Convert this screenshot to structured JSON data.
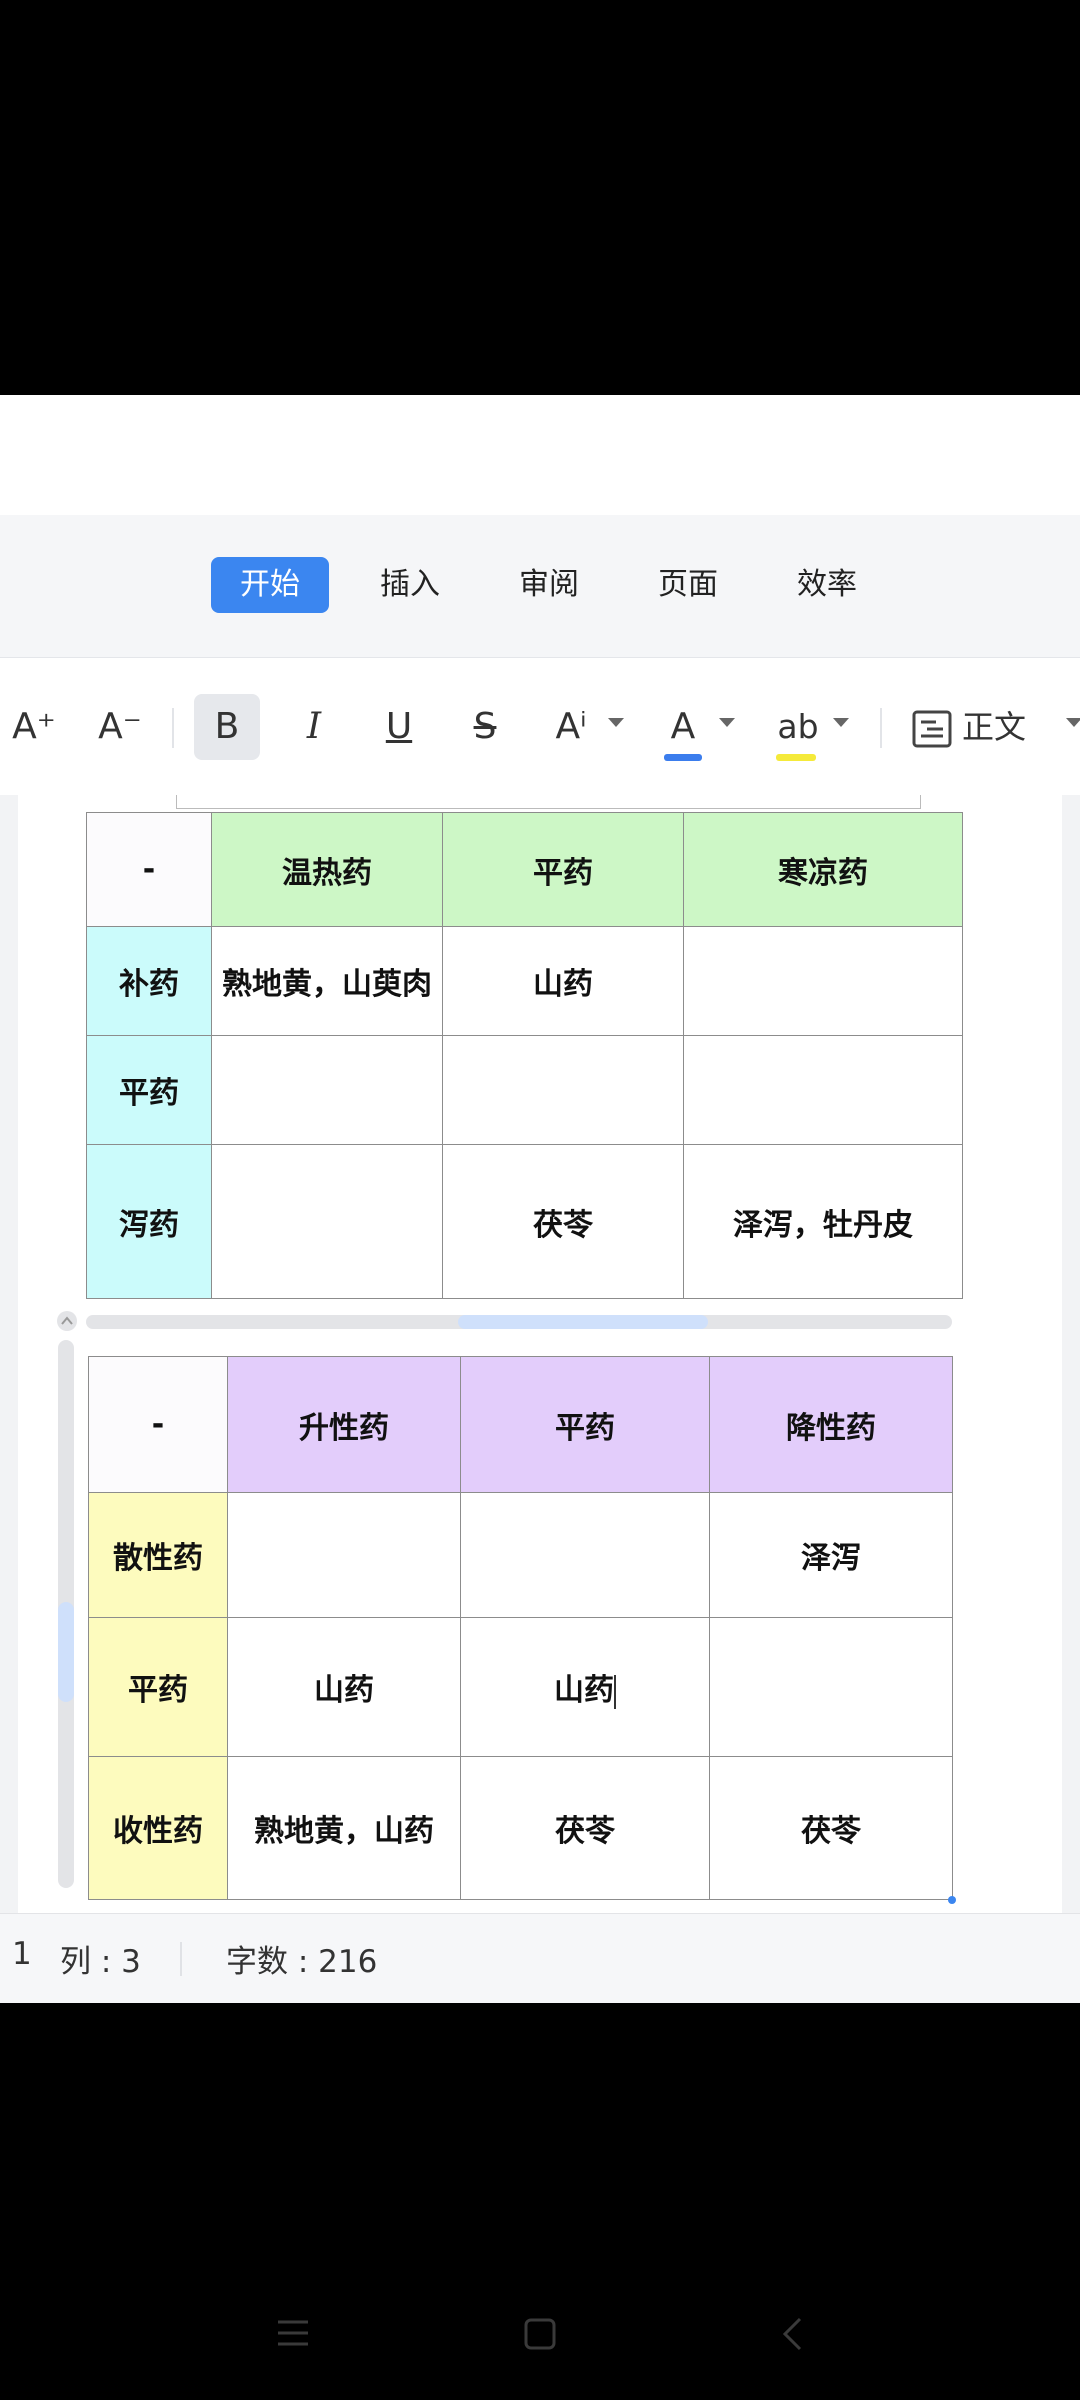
{
  "tabs": [
    "开始",
    "插入",
    "审阅",
    "页面",
    "效率"
  ],
  "toolbar": {
    "font_increase": "A⁺",
    "font_decrease": "A⁻",
    "bold": "B",
    "italic": "I",
    "underline": "U",
    "strike": "S",
    "superscript": "Aⁱ",
    "font_color": "A",
    "font_color_value": "#3b7ded",
    "highlight": "ab",
    "highlight_value": "#f5ea3a",
    "style": "正文"
  },
  "table1": {
    "header": [
      "-",
      "温热药",
      "平药",
      "寒凉药"
    ],
    "rows": [
      [
        "补药",
        "熟地黄，山萸肉",
        "山药",
        ""
      ],
      [
        "平药",
        "",
        "",
        ""
      ],
      [
        "泻药",
        "",
        "茯苓",
        "泽泻，牡丹皮"
      ]
    ]
  },
  "table2": {
    "header": [
      "-",
      "升性药",
      "平药",
      "降性药"
    ],
    "rows": [
      [
        "散性药",
        "",
        "",
        "泽泻"
      ],
      [
        "平药",
        "山药",
        "山药",
        ""
      ],
      [
        "收性药",
        "熟地黄，山药",
        "茯苓",
        "茯苓"
      ]
    ]
  },
  "status": {
    "line": "1",
    "column": "列 : 3",
    "word_count": "字数 : 216"
  }
}
